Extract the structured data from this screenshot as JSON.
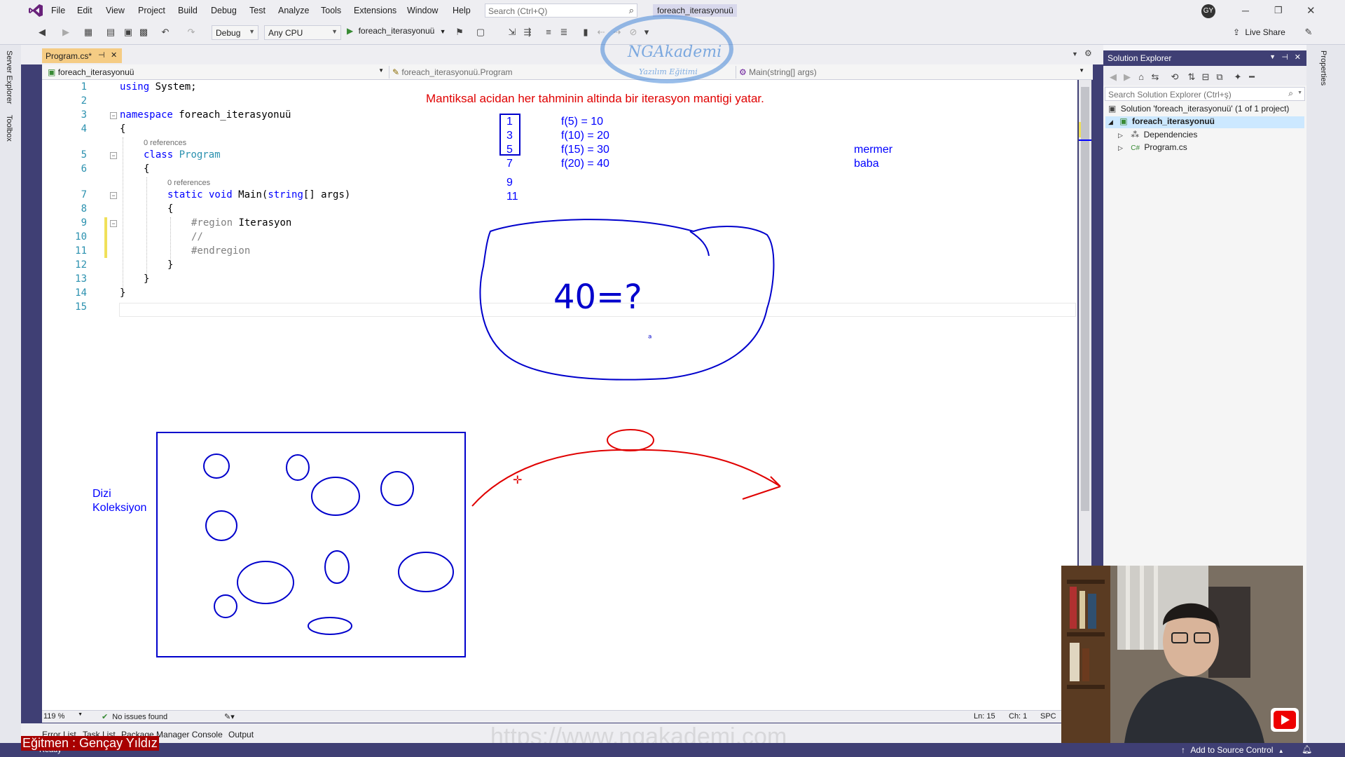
{
  "menu": {
    "items": [
      "File",
      "Edit",
      "View",
      "Project",
      "Build",
      "Debug",
      "Test",
      "Analyze",
      "Tools",
      "Extensions",
      "Window",
      "Help"
    ],
    "search_placeholder": "Search (Ctrl+Q)",
    "solution_name": "foreach_iterasyonuü",
    "user_initials": "GY",
    "live_share": "Live Share"
  },
  "toolbar": {
    "config": "Debug",
    "platform": "Any CPU",
    "start_label": "foreach_iterasyonuü"
  },
  "watermark": {
    "brand": "NGAkademi",
    "tagline": "Yazılım Eğitimi",
    "url": "https://www.ngakademi.com"
  },
  "tab": {
    "label": "Program.cs*",
    "pin": "⊣",
    "close": "✕"
  },
  "navbar": {
    "project": "foreach_iterasyonuü",
    "class": "foreach_iterasyonuü.Program",
    "member": "Main(string[] args)"
  },
  "side_tabs": {
    "server_explorer": "Server Explorer",
    "toolbox": "Toolbox",
    "properties": "Properties"
  },
  "code": {
    "line_numbers": [
      "1",
      "2",
      "3",
      "4",
      "5",
      "6",
      "7",
      "8",
      "9",
      "10",
      "11",
      "12",
      "13",
      "14",
      "15"
    ],
    "l1_kw": "using",
    "l1_rest": " System;",
    "l3_kw": "namespace",
    "l3_rest": " foreach_iterasyonuü",
    "brace_open": "{",
    "brace_close": "}",
    "refs": "0 references",
    "l5_kw": "class",
    "l5_type": " Program",
    "l7_kw1": "static",
    "l7_kw2": " void",
    "l7_rest": " Main(",
    "l7_kw3": "string",
    "l7_rest2": "[] args)",
    "l9_kw": "#region",
    "l9_rest": " Iterasyon",
    "l10": "//",
    "l11_kw": "#endregion"
  },
  "annotations": {
    "heading": "Mantiksal acidan her tahminin altinda bir iterasyon mantigi yatar.",
    "seq": [
      "1",
      "3",
      "5",
      "7",
      "9",
      "11"
    ],
    "funcs": [
      "f(5) = 10",
      "f(10) = 20",
      "f(15) = 30",
      "f(20) = 40"
    ],
    "words": [
      "mermer",
      "baba"
    ],
    "dizi": "Dizi",
    "koleksiyon": "Koleksiyon",
    "handwritten": "40=?"
  },
  "status": {
    "zoom": "119 %",
    "issues": "No issues found",
    "ln": "Ln: 15",
    "ch": "Ch: 1",
    "mode": "SPC"
  },
  "solution_explorer": {
    "title": "Solution Explorer",
    "search_placeholder": "Search Solution Explorer (Ctrl+ş)",
    "solution": "Solution 'foreach_iterasyonuü' (1 of 1 project)",
    "project": "foreach_iterasyonuü",
    "dependencies": "Dependencies",
    "file": "Program.cs"
  },
  "bottom_tabs": [
    "Error List",
    "Task List",
    "Package Manager Console",
    "Output"
  ],
  "statusbar": {
    "ready": "Ready",
    "source_control": "Add to Source Control",
    "instructor": "Eğitmen : Gençay Yıldız"
  },
  "colors": {
    "accent": "#3f3f74",
    "keyword": "#0000ff",
    "type": "#2b91af",
    "red_text": "#e00000",
    "blue_text": "#0000ff"
  }
}
